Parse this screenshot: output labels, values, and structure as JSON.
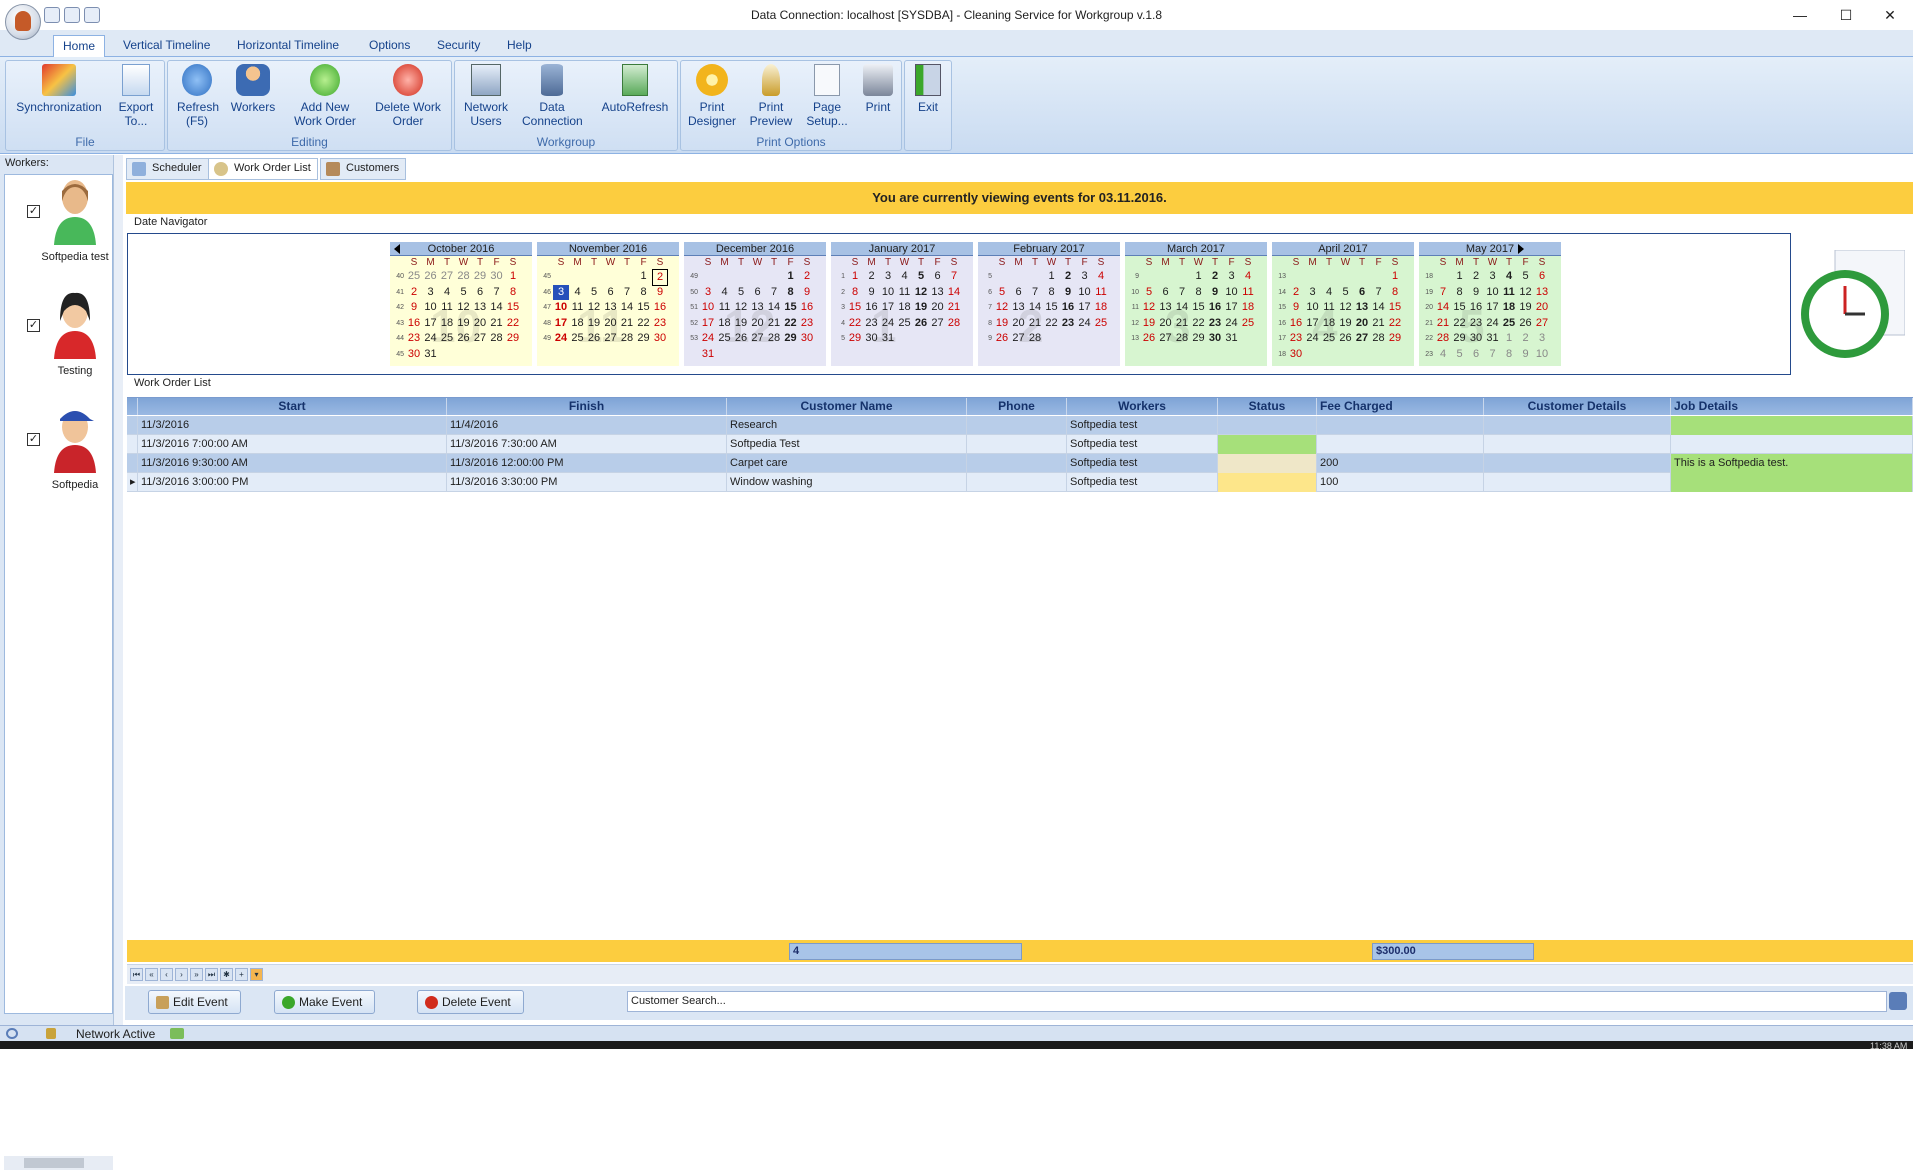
{
  "window": {
    "title": "Data Connection: localhost [SYSDBA] - Cleaning Service for Workgroup v.1.8",
    "minimize": "—",
    "maximize": "☐",
    "close": "✕"
  },
  "ribbon_tabs": [
    "Home",
    "Vertical Timeline",
    "Horizontal Timeline",
    "Options",
    "Security",
    "Help"
  ],
  "groups": {
    "file": "File",
    "editing": "Editing",
    "workgroup": "Workgroup",
    "print": "Print Options"
  },
  "buttons": {
    "sync": "Synchronization",
    "export": "Export To...",
    "refresh": "Refresh (F5)",
    "workers": "Workers",
    "add_wo": "Add New Work Order",
    "delete_wo": "Delete Work Order",
    "network_users": "Network Users",
    "data_connection": "Data Connection",
    "autorefresh": "AutoRefresh",
    "print_designer": "Print Designer",
    "print_preview": "Print Preview",
    "page_setup": "Page Setup...",
    "print": "Print",
    "exit": "Exit"
  },
  "workers_panel": {
    "title": "Workers:",
    "items": [
      {
        "name": "Softpedia test",
        "checked": "✓"
      },
      {
        "name": "Testing",
        "checked": "✓"
      },
      {
        "name": "Softpedia",
        "checked": "✓"
      }
    ]
  },
  "main_tabs": [
    "Scheduler",
    "Work Order List",
    "Customers"
  ],
  "banner": "You are currently viewing events for 03.11.2016.",
  "date_navigator_title": "Date Navigator",
  "day_headers": [
    "S",
    "M",
    "T",
    "W",
    "T",
    "F",
    "S"
  ],
  "months": [
    {
      "name": "October 2016",
      "big": "10",
      "wk": [
        "40",
        "41",
        "42",
        "43",
        "44",
        "45"
      ],
      "days": [
        "25",
        "26",
        "27",
        "28",
        "29",
        "30",
        "1",
        "2",
        "3",
        "4",
        "5",
        "6",
        "7",
        "8",
        "9",
        "10",
        "11",
        "12",
        "13",
        "14",
        "15",
        "16",
        "17",
        "18",
        "19",
        "20",
        "21",
        "22",
        "23",
        "24",
        "25",
        "26",
        "27",
        "28",
        "29",
        "30",
        "31",
        "",
        "",
        "",
        "",
        "",
        ""
      ],
      "lead": 6,
      "bold": [],
      "bg": "#ffffd8"
    },
    {
      "name": "November 2016",
      "big": "11",
      "wk": [
        "45",
        "46",
        "47",
        "48",
        "49"
      ],
      "days": [
        "",
        "",
        "",
        "",
        "",
        "1",
        "2",
        "3",
        "4",
        "5",
        "6",
        "7",
        "8",
        "9",
        "10",
        "11",
        "12",
        "13",
        "14",
        "15",
        "16",
        "17",
        "18",
        "19",
        "20",
        "21",
        "22",
        "23",
        "24",
        "25",
        "26",
        "27",
        "28",
        "29",
        "30"
      ],
      "lead": 0,
      "bold": [
        "10",
        "17",
        "24"
      ],
      "bg": "#ffffd8"
    },
    {
      "name": "December 2016",
      "big": "12",
      "wk": [
        "49",
        "50",
        "51",
        "52",
        "53"
      ],
      "days": [
        "",
        "",
        "",
        "",
        "",
        "1",
        "2",
        "3",
        "4",
        "5",
        "6",
        "7",
        "8",
        "9",
        "10",
        "11",
        "12",
        "13",
        "14",
        "15",
        "16",
        "17",
        "18",
        "19",
        "20",
        "21",
        "22",
        "23",
        "24",
        "25",
        "26",
        "27",
        "28",
        "29",
        "30",
        "31"
      ],
      "lead": 0,
      "bold": [
        "1",
        "8",
        "15",
        "22",
        "29"
      ],
      "bg": "#e6e6f5"
    },
    {
      "name": "January 2017",
      "big": "1",
      "wk": [
        "1",
        "2",
        "3",
        "4",
        "5"
      ],
      "days": [
        "1",
        "2",
        "3",
        "4",
        "5",
        "6",
        "7",
        "8",
        "9",
        "10",
        "11",
        "12",
        "13",
        "14",
        "15",
        "16",
        "17",
        "18",
        "19",
        "20",
        "21",
        "22",
        "23",
        "24",
        "25",
        "26",
        "27",
        "28",
        "29",
        "30",
        "31"
      ],
      "lead": 0,
      "bold": [
        "5",
        "12",
        "19",
        "26"
      ],
      "bg": "#e6e6f5"
    },
    {
      "name": "February 2017",
      "big": "2",
      "wk": [
        "5",
        "6",
        "7",
        "8",
        "9"
      ],
      "days": [
        "",
        "",
        "",
        "1",
        "2",
        "3",
        "4",
        "5",
        "6",
        "7",
        "8",
        "9",
        "10",
        "11",
        "12",
        "13",
        "14",
        "15",
        "16",
        "17",
        "18",
        "19",
        "20",
        "21",
        "22",
        "23",
        "24",
        "25",
        "26",
        "27",
        "28"
      ],
      "lead": 0,
      "bold": [
        "2",
        "9",
        "16",
        "23"
      ],
      "bg": "#e6e6f5"
    },
    {
      "name": "March 2017",
      "big": "3",
      "wk": [
        "9",
        "10",
        "11",
        "12",
        "13"
      ],
      "days": [
        "",
        "",
        "",
        "1",
        "2",
        "3",
        "4",
        "5",
        "6",
        "7",
        "8",
        "9",
        "10",
        "11",
        "12",
        "13",
        "14",
        "15",
        "16",
        "17",
        "18",
        "19",
        "20",
        "21",
        "22",
        "23",
        "24",
        "25",
        "26",
        "27",
        "28",
        "29",
        "30",
        "31"
      ],
      "lead": 0,
      "bold": [
        "2",
        "9",
        "16",
        "23",
        "30"
      ],
      "bg": "#d7f5d0"
    },
    {
      "name": "April 2017",
      "big": "4",
      "wk": [
        "13",
        "14",
        "15",
        "16",
        "17",
        "18"
      ],
      "days": [
        "",
        "",
        "",
        "",
        "",
        "",
        "1",
        "2",
        "3",
        "4",
        "5",
        "6",
        "7",
        "8",
        "9",
        "10",
        "11",
        "12",
        "13",
        "14",
        "15",
        "16",
        "17",
        "18",
        "19",
        "20",
        "21",
        "22",
        "23",
        "24",
        "25",
        "26",
        "27",
        "28",
        "29",
        "30"
      ],
      "lead": 0,
      "bold": [
        "6",
        "13",
        "20",
        "27"
      ],
      "bg": "#d7f5d0"
    },
    {
      "name": "May 2017",
      "big": "5",
      "wk": [
        "18",
        "19",
        "20",
        "21",
        "22",
        "23"
      ],
      "days": [
        "",
        "1",
        "2",
        "3",
        "4",
        "5",
        "6",
        "7",
        "8",
        "9",
        "10",
        "11",
        "12",
        "13",
        "14",
        "15",
        "16",
        "17",
        "18",
        "19",
        "20",
        "21",
        "22",
        "23",
        "24",
        "25",
        "26",
        "27",
        "28",
        "29",
        "30",
        "31",
        "1",
        "2",
        "3",
        "4",
        "5",
        "6",
        "7",
        "8",
        "9",
        "10"
      ],
      "lead": 0,
      "bold": [
        "4",
        "11",
        "18",
        "25"
      ],
      "bg": "#d7f5d0"
    }
  ],
  "work_order_list_title": "Work Order List",
  "columns": [
    "Start",
    "Finish",
    "Customer Name",
    "Phone",
    "Workers",
    "Status",
    "Fee Charged",
    "Customer Details",
    "Job Details"
  ],
  "rows": [
    [
      "11/3/2016",
      "11/4/2016",
      "Research",
      "",
      "Softpedia test",
      "",
      "",
      "",
      ""
    ],
    [
      "11/3/2016 7:00:00 AM",
      "11/3/2016 7:30:00 AM",
      "Softpedia Test",
      "",
      "Softpedia test",
      "",
      "",
      "",
      ""
    ],
    [
      "11/3/2016 9:30:00 AM",
      "11/3/2016 12:00:00 PM",
      "Carpet care",
      "",
      "Softpedia test",
      "",
      "200",
      "",
      "This is a Softpedia test."
    ],
    [
      "11/3/2016 3:00:00 PM",
      "11/3/2016 3:30:00 PM",
      "Window washing",
      "",
      "Softpedia test",
      "",
      "100",
      "",
      ""
    ]
  ],
  "footer": {
    "count": "4",
    "fee_total": "$300.00"
  },
  "bottom": {
    "edit": "Edit Event",
    "make": "Make Event",
    "delete": "Delete Event",
    "search_placeholder": "Customer Search..."
  },
  "status": {
    "network": "Network Active",
    "clock": "11:38 AM"
  },
  "colors": {
    "banner": "#fccd3f",
    "ribbon": "#c9dbf1",
    "row_selected": "#b8cde9",
    "row_alt": "#e3ecf8",
    "status_green": "#a6e07a",
    "status_yellow": "#fde68a"
  }
}
